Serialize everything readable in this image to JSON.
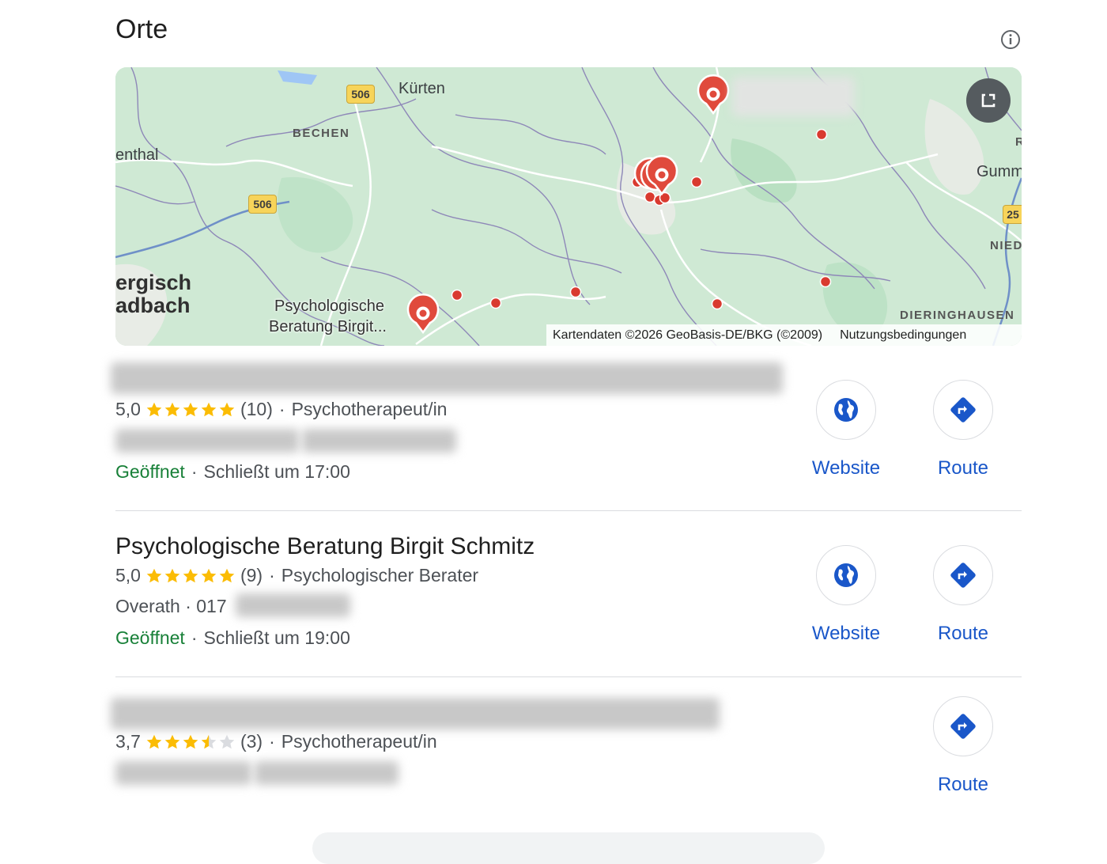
{
  "header": {
    "title": "Orte"
  },
  "map": {
    "labels": {
      "kuerten": "Kürten",
      "bechen": "BECHEN",
      "enthal": "enthal",
      "gumm": "Gumm",
      "nied": "NIED",
      "dieringhausen": "DIERINGHAUSEN",
      "bergisch": "ergisch",
      "gladbach": "adbach",
      "r": "R",
      "place_line1": "Psychologische",
      "place_line2": "Beratung Birgit..."
    },
    "shields": {
      "s1": "506",
      "s2": "506",
      "s3": "25"
    },
    "footer": {
      "copyright": "Kartendaten ©2026 GeoBasis-DE/BKG (©2009)",
      "terms": "Nutzungsbedingungen"
    }
  },
  "results": [
    {
      "rating": "5,0",
      "stars": 5,
      "reviews": "(10)",
      "category": "Psychotherapeut/in",
      "status_open": "Geöffnet",
      "status_hours": "Schließt um 17:00"
    },
    {
      "name": "Psychologische Beratung Birgit Schmitz",
      "rating": "5,0",
      "stars": 5,
      "reviews": "(9)",
      "category": "Psychologischer Berater",
      "location": "Overath · 017",
      "status_open": "Geöffnet",
      "status_hours": "Schließt um 19:00"
    },
    {
      "rating": "3,7",
      "stars": 3.5,
      "reviews": "(3)",
      "category": "Psychotherapeut/in"
    }
  ],
  "actions": {
    "website": "Website",
    "route": "Route"
  },
  "sep": "·",
  "colors": {
    "accent": "#1a57c9",
    "open": "#188038",
    "star": "#fbbc04",
    "pin": "#ea4335"
  }
}
